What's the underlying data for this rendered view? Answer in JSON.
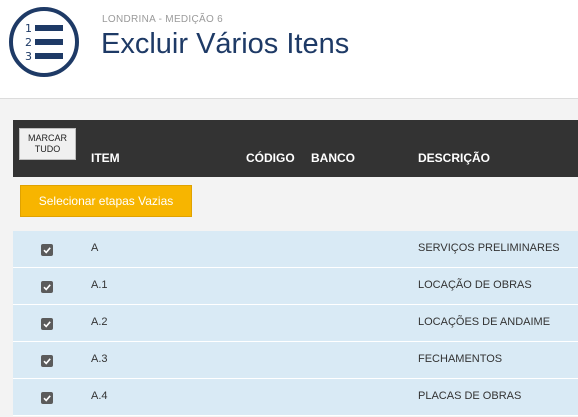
{
  "header": {
    "breadcrumb": "LONDRINA - MEDIÇÃO 6",
    "title": "Excluir Vários Itens",
    "logo_icon": "numbered-list-icon",
    "logo_numbers": [
      "1",
      "2",
      "3"
    ]
  },
  "table": {
    "mark_all_label": "MARCAR\nTUDO",
    "columns": {
      "item": "ITEM",
      "codigo": "CÓDIGO",
      "banco": "BANCO",
      "descricao": "DESCRIÇÃO"
    },
    "select_empty_label": "Selecionar etapas Vazias",
    "rows": [
      {
        "checked": true,
        "item": "A",
        "codigo": "",
        "banco": "",
        "descricao": "SERVIÇOS PRELIMINARES"
      },
      {
        "checked": true,
        "item": "A.1",
        "codigo": "",
        "banco": "",
        "descricao": "LOCAÇÃO DE OBRAS"
      },
      {
        "checked": true,
        "item": "A.2",
        "codigo": "",
        "banco": "",
        "descricao": "LOCAÇÕES DE ANDAIME"
      },
      {
        "checked": true,
        "item": "A.3",
        "codigo": "",
        "banco": "",
        "descricao": "FECHAMENTOS"
      },
      {
        "checked": true,
        "item": "A.4",
        "codigo": "",
        "banco": "",
        "descricao": "PLACAS DE OBRAS"
      }
    ]
  },
  "colors": {
    "title": "#1e3a66",
    "table_header_bg": "#333333",
    "button_yellow": "#f7b500",
    "row_bg": "#d9eaf5",
    "checkbox": "#5b5b5b"
  }
}
